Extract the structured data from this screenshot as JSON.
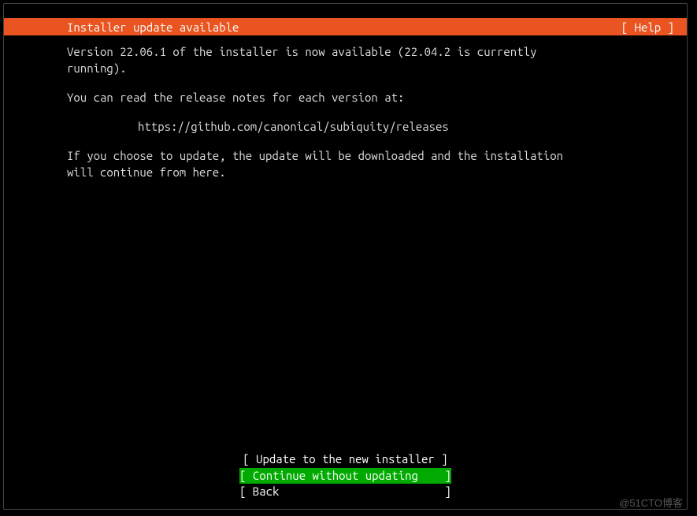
{
  "header": {
    "title": "Installer update available",
    "help": "[ Help ]"
  },
  "body": {
    "line1": "Version 22.06.1 of the installer is now available (22.04.2 is currently\nrunning).",
    "line2": "You can read the release notes for each version at:",
    "url": "https://github.com/canonical/subiquity/releases",
    "line3": "If you choose to update, the update will be downloaded and the installation\nwill continue from here."
  },
  "buttons": {
    "update": "[ Update to the new installer ]",
    "continue": "[ Continue without updating    ]",
    "back": "[ Back                         ]"
  },
  "watermark": "@51CTO博客"
}
